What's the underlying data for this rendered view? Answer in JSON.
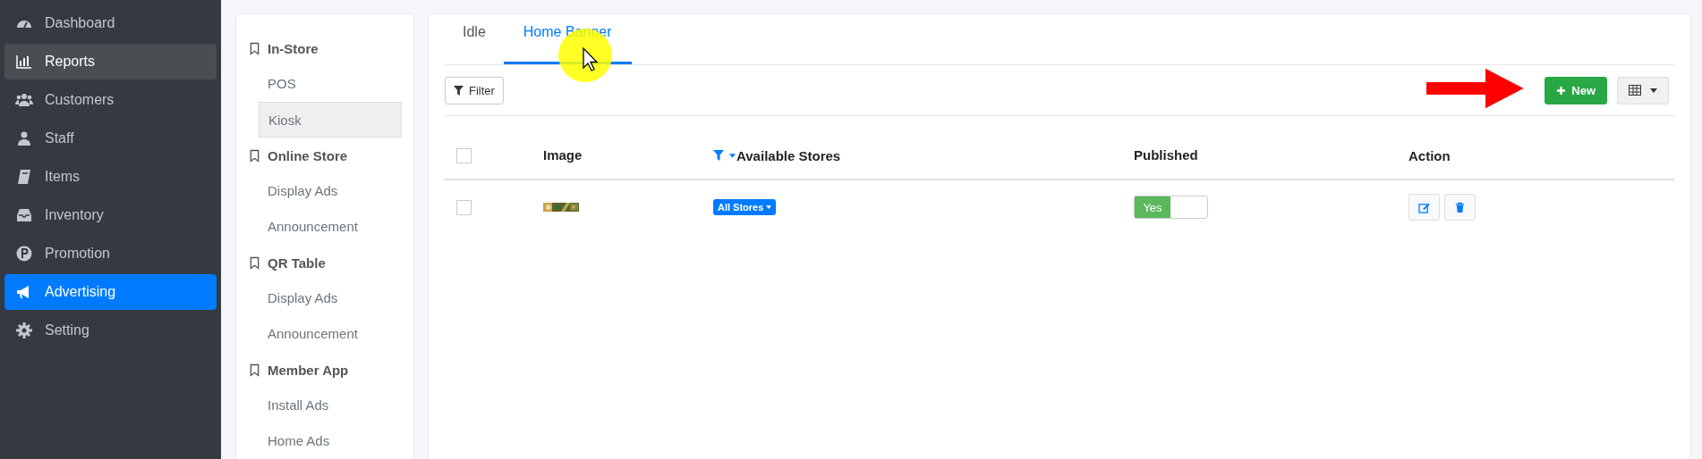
{
  "sidebar": {
    "items": [
      {
        "label": "Dashboard",
        "selected": false,
        "hovered": false
      },
      {
        "label": "Reports",
        "selected": false,
        "hovered": true
      },
      {
        "label": "Customers",
        "selected": false,
        "hovered": false
      },
      {
        "label": "Staff",
        "selected": false,
        "hovered": false
      },
      {
        "label": "Items",
        "selected": false,
        "hovered": false
      },
      {
        "label": "Inventory",
        "selected": false,
        "hovered": false
      },
      {
        "label": "Promotion",
        "selected": false,
        "hovered": false
      },
      {
        "label": "Advertising",
        "selected": true,
        "hovered": false
      },
      {
        "label": "Setting",
        "selected": false,
        "hovered": false
      }
    ]
  },
  "submenu": {
    "groups": [
      {
        "title": "In-Store",
        "items": [
          {
            "label": "POS",
            "selected": false
          },
          {
            "label": "Kiosk",
            "selected": true
          }
        ]
      },
      {
        "title": "Online Store",
        "items": [
          {
            "label": "Display Ads",
            "selected": false
          },
          {
            "label": "Announcement",
            "selected": false
          }
        ]
      },
      {
        "title": "QR Table",
        "items": [
          {
            "label": "Display Ads",
            "selected": false
          },
          {
            "label": "Announcement",
            "selected": false
          }
        ]
      },
      {
        "title": "Member App",
        "items": [
          {
            "label": "Install Ads",
            "selected": false
          },
          {
            "label": "Home Ads",
            "selected": false
          }
        ]
      }
    ]
  },
  "tabs": [
    {
      "label": "Idle",
      "selected": false
    },
    {
      "label": "Home Banner",
      "selected": true
    }
  ],
  "toolbar": {
    "filter": "Filter",
    "new": "New"
  },
  "table": {
    "columns": [
      "Image",
      "Available Stores",
      "Published",
      "Action"
    ],
    "header_checked": false,
    "rows": [
      {
        "checked": false,
        "stores": "All Stores",
        "published": {
          "label": "Yes",
          "on": true
        }
      }
    ]
  }
}
